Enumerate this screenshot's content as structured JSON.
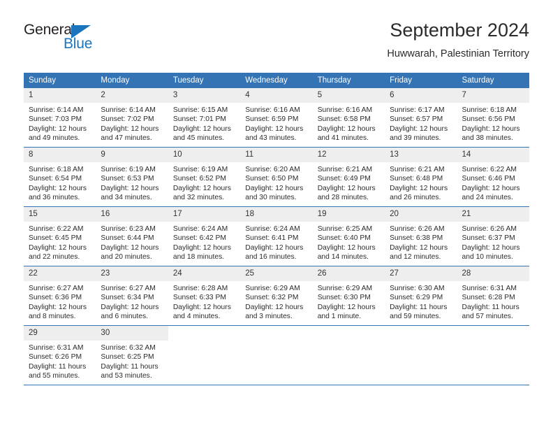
{
  "brand": {
    "name_part1": "General",
    "name_part2": "Blue",
    "triangle_color": "#1a75bc",
    "text_color": "#231f20"
  },
  "header": {
    "title": "September 2024",
    "subtitle": "Huwwarah, Palestinian Territory"
  },
  "colors": {
    "header_row_bg": "#3474b4",
    "header_row_text": "#ffffff",
    "daynum_bg": "#eeeeee",
    "cell_bg": "#ffffff",
    "row_divider": "#3474b4",
    "body_text": "#2b2b2b"
  },
  "weekday_headers": [
    "Sunday",
    "Monday",
    "Tuesday",
    "Wednesday",
    "Thursday",
    "Friday",
    "Saturday"
  ],
  "weeks": [
    [
      {
        "day": "1",
        "sunrise": "Sunrise: 6:14 AM",
        "sunset": "Sunset: 7:03 PM",
        "daylight_line1": "Daylight: 12 hours",
        "daylight_line2": "and 49 minutes."
      },
      {
        "day": "2",
        "sunrise": "Sunrise: 6:14 AM",
        "sunset": "Sunset: 7:02 PM",
        "daylight_line1": "Daylight: 12 hours",
        "daylight_line2": "and 47 minutes."
      },
      {
        "day": "3",
        "sunrise": "Sunrise: 6:15 AM",
        "sunset": "Sunset: 7:01 PM",
        "daylight_line1": "Daylight: 12 hours",
        "daylight_line2": "and 45 minutes."
      },
      {
        "day": "4",
        "sunrise": "Sunrise: 6:16 AM",
        "sunset": "Sunset: 6:59 PM",
        "daylight_line1": "Daylight: 12 hours",
        "daylight_line2": "and 43 minutes."
      },
      {
        "day": "5",
        "sunrise": "Sunrise: 6:16 AM",
        "sunset": "Sunset: 6:58 PM",
        "daylight_line1": "Daylight: 12 hours",
        "daylight_line2": "and 41 minutes."
      },
      {
        "day": "6",
        "sunrise": "Sunrise: 6:17 AM",
        "sunset": "Sunset: 6:57 PM",
        "daylight_line1": "Daylight: 12 hours",
        "daylight_line2": "and 39 minutes."
      },
      {
        "day": "7",
        "sunrise": "Sunrise: 6:18 AM",
        "sunset": "Sunset: 6:56 PM",
        "daylight_line1": "Daylight: 12 hours",
        "daylight_line2": "and 38 minutes."
      }
    ],
    [
      {
        "day": "8",
        "sunrise": "Sunrise: 6:18 AM",
        "sunset": "Sunset: 6:54 PM",
        "daylight_line1": "Daylight: 12 hours",
        "daylight_line2": "and 36 minutes."
      },
      {
        "day": "9",
        "sunrise": "Sunrise: 6:19 AM",
        "sunset": "Sunset: 6:53 PM",
        "daylight_line1": "Daylight: 12 hours",
        "daylight_line2": "and 34 minutes."
      },
      {
        "day": "10",
        "sunrise": "Sunrise: 6:19 AM",
        "sunset": "Sunset: 6:52 PM",
        "daylight_line1": "Daylight: 12 hours",
        "daylight_line2": "and 32 minutes."
      },
      {
        "day": "11",
        "sunrise": "Sunrise: 6:20 AM",
        "sunset": "Sunset: 6:50 PM",
        "daylight_line1": "Daylight: 12 hours",
        "daylight_line2": "and 30 minutes."
      },
      {
        "day": "12",
        "sunrise": "Sunrise: 6:21 AM",
        "sunset": "Sunset: 6:49 PM",
        "daylight_line1": "Daylight: 12 hours",
        "daylight_line2": "and 28 minutes."
      },
      {
        "day": "13",
        "sunrise": "Sunrise: 6:21 AM",
        "sunset": "Sunset: 6:48 PM",
        "daylight_line1": "Daylight: 12 hours",
        "daylight_line2": "and 26 minutes."
      },
      {
        "day": "14",
        "sunrise": "Sunrise: 6:22 AM",
        "sunset": "Sunset: 6:46 PM",
        "daylight_line1": "Daylight: 12 hours",
        "daylight_line2": "and 24 minutes."
      }
    ],
    [
      {
        "day": "15",
        "sunrise": "Sunrise: 6:22 AM",
        "sunset": "Sunset: 6:45 PM",
        "daylight_line1": "Daylight: 12 hours",
        "daylight_line2": "and 22 minutes."
      },
      {
        "day": "16",
        "sunrise": "Sunrise: 6:23 AM",
        "sunset": "Sunset: 6:44 PM",
        "daylight_line1": "Daylight: 12 hours",
        "daylight_line2": "and 20 minutes."
      },
      {
        "day": "17",
        "sunrise": "Sunrise: 6:24 AM",
        "sunset": "Sunset: 6:42 PM",
        "daylight_line1": "Daylight: 12 hours",
        "daylight_line2": "and 18 minutes."
      },
      {
        "day": "18",
        "sunrise": "Sunrise: 6:24 AM",
        "sunset": "Sunset: 6:41 PM",
        "daylight_line1": "Daylight: 12 hours",
        "daylight_line2": "and 16 minutes."
      },
      {
        "day": "19",
        "sunrise": "Sunrise: 6:25 AM",
        "sunset": "Sunset: 6:40 PM",
        "daylight_line1": "Daylight: 12 hours",
        "daylight_line2": "and 14 minutes."
      },
      {
        "day": "20",
        "sunrise": "Sunrise: 6:26 AM",
        "sunset": "Sunset: 6:38 PM",
        "daylight_line1": "Daylight: 12 hours",
        "daylight_line2": "and 12 minutes."
      },
      {
        "day": "21",
        "sunrise": "Sunrise: 6:26 AM",
        "sunset": "Sunset: 6:37 PM",
        "daylight_line1": "Daylight: 12 hours",
        "daylight_line2": "and 10 minutes."
      }
    ],
    [
      {
        "day": "22",
        "sunrise": "Sunrise: 6:27 AM",
        "sunset": "Sunset: 6:36 PM",
        "daylight_line1": "Daylight: 12 hours",
        "daylight_line2": "and 8 minutes."
      },
      {
        "day": "23",
        "sunrise": "Sunrise: 6:27 AM",
        "sunset": "Sunset: 6:34 PM",
        "daylight_line1": "Daylight: 12 hours",
        "daylight_line2": "and 6 minutes."
      },
      {
        "day": "24",
        "sunrise": "Sunrise: 6:28 AM",
        "sunset": "Sunset: 6:33 PM",
        "daylight_line1": "Daylight: 12 hours",
        "daylight_line2": "and 4 minutes."
      },
      {
        "day": "25",
        "sunrise": "Sunrise: 6:29 AM",
        "sunset": "Sunset: 6:32 PM",
        "daylight_line1": "Daylight: 12 hours",
        "daylight_line2": "and 3 minutes."
      },
      {
        "day": "26",
        "sunrise": "Sunrise: 6:29 AM",
        "sunset": "Sunset: 6:30 PM",
        "daylight_line1": "Daylight: 12 hours",
        "daylight_line2": "and 1 minute."
      },
      {
        "day": "27",
        "sunrise": "Sunrise: 6:30 AM",
        "sunset": "Sunset: 6:29 PM",
        "daylight_line1": "Daylight: 11 hours",
        "daylight_line2": "and 59 minutes."
      },
      {
        "day": "28",
        "sunrise": "Sunrise: 6:31 AM",
        "sunset": "Sunset: 6:28 PM",
        "daylight_line1": "Daylight: 11 hours",
        "daylight_line2": "and 57 minutes."
      }
    ],
    [
      {
        "day": "29",
        "sunrise": "Sunrise: 6:31 AM",
        "sunset": "Sunset: 6:26 PM",
        "daylight_line1": "Daylight: 11 hours",
        "daylight_line2": "and 55 minutes."
      },
      {
        "day": "30",
        "sunrise": "Sunrise: 6:32 AM",
        "sunset": "Sunset: 6:25 PM",
        "daylight_line1": "Daylight: 11 hours",
        "daylight_line2": "and 53 minutes."
      },
      {
        "day": "",
        "sunrise": "",
        "sunset": "",
        "daylight_line1": "",
        "daylight_line2": ""
      },
      {
        "day": "",
        "sunrise": "",
        "sunset": "",
        "daylight_line1": "",
        "daylight_line2": ""
      },
      {
        "day": "",
        "sunrise": "",
        "sunset": "",
        "daylight_line1": "",
        "daylight_line2": ""
      },
      {
        "day": "",
        "sunrise": "",
        "sunset": "",
        "daylight_line1": "",
        "daylight_line2": ""
      },
      {
        "day": "",
        "sunrise": "",
        "sunset": "",
        "daylight_line1": "",
        "daylight_line2": ""
      }
    ]
  ]
}
